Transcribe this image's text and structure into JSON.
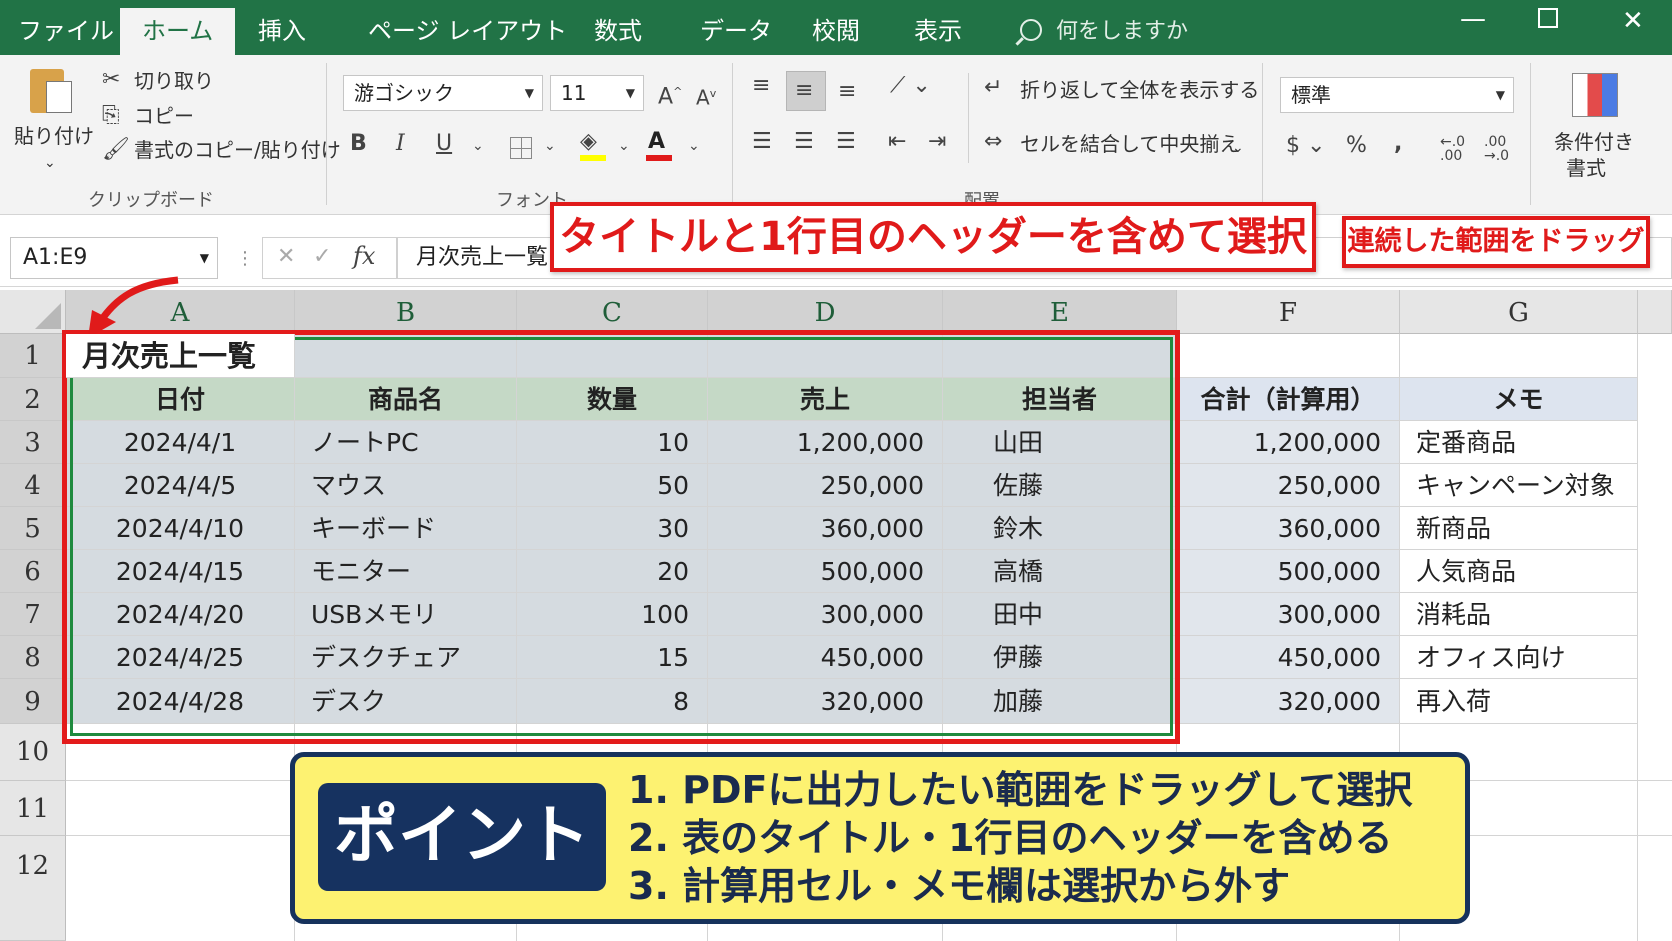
{
  "tabs": {
    "file": "ファイル",
    "home": "ホーム",
    "insert": "挿入",
    "page_layout": "ページ レイアウト",
    "formulas": "数式",
    "data": "データ",
    "review": "校閲",
    "view": "表示"
  },
  "tell_me": "何をしますか",
  "ribbon": {
    "paste": "貼り付け",
    "cut": "切り取り",
    "copy": "コピー",
    "format_painter": "書式のコピー/貼り付け",
    "clipboard": "クリップボード",
    "font_name": "游ゴシック",
    "font_size": "11",
    "font_group": "フォント",
    "alignment_group": "配置",
    "wrap_text": "折り返して全体を表示する",
    "merge_center": "セルを結合して中央揃え",
    "number_format": "標準",
    "conditional_format_1": "条件付き",
    "conditional_format_2": "書式",
    "bold": "B",
    "italic": "I",
    "underline": "U",
    "percent": "%",
    "comma": ","
  },
  "formula_bar": {
    "name_box": "A1:E9",
    "fx": "fx",
    "content": "月次売上一覧"
  },
  "columns": [
    "A",
    "B",
    "C",
    "D",
    "E",
    "F",
    "G"
  ],
  "rows": [
    "1",
    "2",
    "3",
    "4",
    "5",
    "6",
    "7",
    "8",
    "9",
    "10",
    "11",
    "12"
  ],
  "sheet": {
    "title": "月次売上一覧",
    "headers": [
      "日付",
      "商品名",
      "数量",
      "売上",
      "担当者",
      "合計（計算用）",
      "メモ"
    ],
    "data": [
      [
        "2024/4/1",
        "ノートPC",
        "10",
        "1,200,000",
        "山田",
        "1,200,000",
        "定番商品"
      ],
      [
        "2024/4/5",
        "マウス",
        "50",
        "250,000",
        "佐藤",
        "250,000",
        "キャンペーン対象"
      ],
      [
        "2024/4/10",
        "キーボード",
        "30",
        "360,000",
        "鈴木",
        "360,000",
        "新商品"
      ],
      [
        "2024/4/15",
        "モニター",
        "20",
        "500,000",
        "高橋",
        "500,000",
        "人気商品"
      ],
      [
        "2024/4/20",
        "USBメモリ",
        "100",
        "300,000",
        "田中",
        "300,000",
        "消耗品"
      ],
      [
        "2024/4/25",
        "デスクチェア",
        "15",
        "450,000",
        "伊藤",
        "450,000",
        "オフィス向け"
      ],
      [
        "2024/4/28",
        "デスク",
        "8",
        "320,000",
        "加藤",
        "320,000",
        "再入荷"
      ]
    ]
  },
  "annotations": {
    "callout_main": "タイトルと1行目のヘッダーを含めて選択",
    "callout_drag": "連続した範囲をドラッグ",
    "point_title": "ポイント",
    "points": [
      "1. PDFに出力したい範囲をドラッグして選択",
      "2. 表のタイトル・1行目のヘッダーを含める",
      "3. 計算用セル・メモ欄は選択から外す"
    ]
  },
  "colors": {
    "excel_green": "#217346",
    "selection_red": "#e31b1b",
    "selection_green": "#1f8a3e",
    "point_yellow": "#fdf271",
    "point_navy": "#163260"
  },
  "icons": [
    "search-icon",
    "paste-icon",
    "cut-icon",
    "copy-icon",
    "format-painter-icon",
    "borders-icon",
    "fill-color-icon",
    "font-color-icon",
    "conditional-formatting-icon",
    "minimize-icon",
    "maximize-icon",
    "close-icon",
    "cancel-icon",
    "enter-icon"
  ]
}
